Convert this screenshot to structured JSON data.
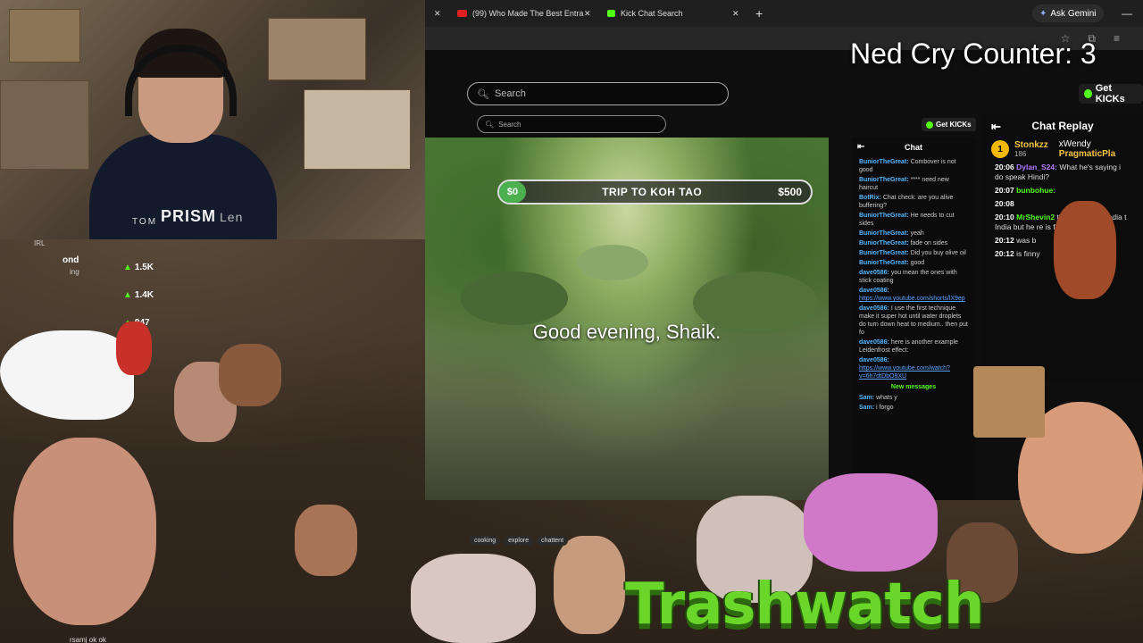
{
  "browser": {
    "tabs": [
      {
        "title": "(99) Who Made The Best Entra",
        "fav_color": "#e02020"
      },
      {
        "title": "Kick Chat Search",
        "fav_color": "#53fc18"
      }
    ],
    "ask_gemini": "Ask Gemini"
  },
  "kick_page": {
    "search_placeholder": "Search",
    "get_kicks": "Get KICKs",
    "inner_search_placeholder": "Search",
    "inner_get_kicks": "Get KICKs",
    "donation": {
      "min": "$0",
      "title": "TRIP TO KOH TAO",
      "max": "$500"
    },
    "greeting": "Good evening, Shaik.",
    "chat_title": "Chat",
    "chat_messages": [
      {
        "user": "BuniorTheGreat:",
        "text": "Combover is not good"
      },
      {
        "user": "BuniorTheGreat:",
        "text": "**** need new haircut"
      },
      {
        "user": "BotRix:",
        "text": "Chat check: are you alive buffering?"
      },
      {
        "user": "BuniorTheGreat:",
        "text": "He needs to cut sides"
      },
      {
        "user": "BuniorTheGreat:",
        "text": "yeah"
      },
      {
        "user": "BuniorTheGreat:",
        "text": "fade on sides"
      },
      {
        "user": "BuniorTheGreat:",
        "text": "Did you buy olive oil"
      },
      {
        "user": "BuniorTheGreat:",
        "text": "good"
      },
      {
        "user": "dave0586:",
        "text": "you mean the ones with stick coating"
      },
      {
        "user": "dave0586:",
        "text": "https://www.youtube.com/shorts/lX9ep"
      },
      {
        "user": "dave0586:",
        "text": "I use the first technique make it super hot until water droplets do turn down heat to medium.. then put fo"
      },
      {
        "user": "dave0586:",
        "text": "here is another example Leidenfrost effect:"
      },
      {
        "user": "dave0586:",
        "text": "https://www.youtube.com/watch?v=6h7dtDbO8XU"
      }
    ],
    "new_messages": "New messages",
    "chat_tail": [
      {
        "user": "Sam:",
        "text": "whats y"
      },
      {
        "user": "Sam:",
        "text": "i forgo"
      }
    ]
  },
  "overlay": {
    "counter": "Ned Cry Counter: 3",
    "get_kicks": "Get KICKs",
    "chat_replay_title": "Chat Replay",
    "top_gifter": {
      "rank": "1",
      "name": "Stonkzz",
      "count": "186"
    },
    "top_right_names": [
      "xWendy",
      "PragmaticPla"
    ],
    "replay_lines": [
      {
        "time": "20:06",
        "user": "Dylan_S24:",
        "text": "What he's saying i do speak Hindi?"
      },
      {
        "time": "20:07",
        "user": "bunbohue:",
        "text": ""
      },
      {
        "time": "20:08",
        "user": "",
        "text": ""
      },
      {
        "time": "20:10",
        "user": "MrShevin2",
        "text": "the dude from India t India but he re is f Indian"
      },
      {
        "time": "20:12",
        "user": "",
        "text": "was b"
      },
      {
        "time": "20:12",
        "user": "",
        "text": "is finny"
      }
    ],
    "stats": [
      "1.5K",
      "1.4K",
      "947"
    ],
    "webcam_brand": "PRISM",
    "webcam_brand_suffix": "Len",
    "shirt_text": "TOM",
    "chips": [
      "cooking",
      "explore",
      "chattent"
    ],
    "trash_logo": "Trashwatch",
    "bottom_text": "rsamj ok ok",
    "irl_label": "IRL",
    "irl_name": "ond",
    "irl_sub": "ing"
  }
}
